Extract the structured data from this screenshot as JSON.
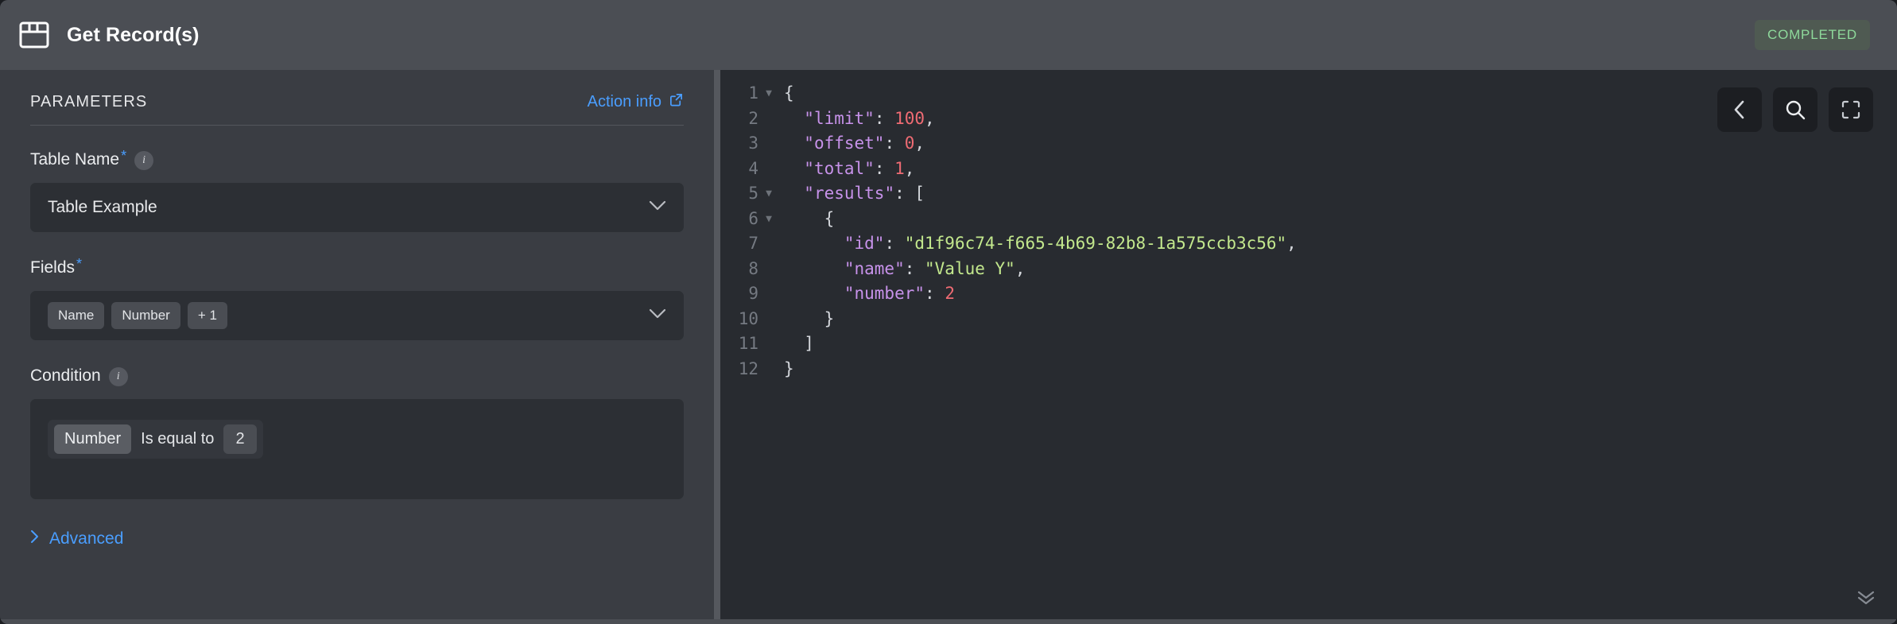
{
  "header": {
    "icon": "table-window-icon",
    "title": "Get Record(s)",
    "status": "COMPLETED",
    "status_color": "#8ed99b"
  },
  "parameters": {
    "section_title": "PARAMETERS",
    "action_info_label": "Action info",
    "action_info_icon": "external-link-icon",
    "table_name": {
      "label": "Table Name",
      "required_marker": "*",
      "info_icon": "info-icon",
      "value": "Table Example",
      "chevron": "chevron-down-icon"
    },
    "fields": {
      "label": "Fields",
      "required_marker": "*",
      "chips": [
        "Name",
        "Number",
        "+ 1"
      ],
      "chevron": "chevron-down-icon"
    },
    "condition": {
      "label": "Condition",
      "info_icon": "info-icon",
      "field": "Number",
      "operator": "Is equal to",
      "value": "2"
    },
    "advanced": {
      "label": "Advanced",
      "chevron": "chevron-right-icon",
      "color": "#4a9eff"
    }
  },
  "code_panel": {
    "toolbar": [
      {
        "name": "back-button",
        "icon": "chevron-left-icon"
      },
      {
        "name": "search-button",
        "icon": "search-icon"
      },
      {
        "name": "fullscreen-button",
        "icon": "fullscreen-icon"
      }
    ],
    "scroll_hint_icon": "double-chevron-down-icon",
    "lines": [
      {
        "n": "1",
        "fold": "▼",
        "indent": 0,
        "tokens": [
          {
            "t": "pun",
            "v": "{"
          }
        ]
      },
      {
        "n": "2",
        "fold": "",
        "indent": 1,
        "tokens": [
          {
            "t": "key",
            "v": "\"limit\""
          },
          {
            "t": "pun",
            "v": ": "
          },
          {
            "t": "num",
            "v": "100"
          },
          {
            "t": "pun",
            "v": ","
          }
        ]
      },
      {
        "n": "3",
        "fold": "",
        "indent": 1,
        "tokens": [
          {
            "t": "key",
            "v": "\"offset\""
          },
          {
            "t": "pun",
            "v": ": "
          },
          {
            "t": "num",
            "v": "0"
          },
          {
            "t": "pun",
            "v": ","
          }
        ]
      },
      {
        "n": "4",
        "fold": "",
        "indent": 1,
        "tokens": [
          {
            "t": "key",
            "v": "\"total\""
          },
          {
            "t": "pun",
            "v": ": "
          },
          {
            "t": "num",
            "v": "1"
          },
          {
            "t": "pun",
            "v": ","
          }
        ]
      },
      {
        "n": "5",
        "fold": "▼",
        "indent": 1,
        "tokens": [
          {
            "t": "key",
            "v": "\"results\""
          },
          {
            "t": "pun",
            "v": ": ["
          }
        ]
      },
      {
        "n": "6",
        "fold": "▼",
        "indent": 2,
        "tokens": [
          {
            "t": "pun",
            "v": "{"
          }
        ]
      },
      {
        "n": "7",
        "fold": "",
        "indent": 3,
        "tokens": [
          {
            "t": "key",
            "v": "\"id\""
          },
          {
            "t": "pun",
            "v": ": "
          },
          {
            "t": "str",
            "v": "\"d1f96c74-f665-4b69-82b8-1a575ccb3c56\""
          },
          {
            "t": "pun",
            "v": ","
          }
        ]
      },
      {
        "n": "8",
        "fold": "",
        "indent": 3,
        "tokens": [
          {
            "t": "key",
            "v": "\"name\""
          },
          {
            "t": "pun",
            "v": ": "
          },
          {
            "t": "str",
            "v": "\"Value Y\""
          },
          {
            "t": "pun",
            "v": ","
          }
        ]
      },
      {
        "n": "9",
        "fold": "",
        "indent": 3,
        "tokens": [
          {
            "t": "key",
            "v": "\"number\""
          },
          {
            "t": "pun",
            "v": ": "
          },
          {
            "t": "num",
            "v": "2"
          }
        ]
      },
      {
        "n": "10",
        "fold": "",
        "indent": 2,
        "tokens": [
          {
            "t": "pun",
            "v": "}"
          }
        ]
      },
      {
        "n": "11",
        "fold": "",
        "indent": 1,
        "tokens": [
          {
            "t": "pun",
            "v": "]"
          }
        ]
      },
      {
        "n": "12",
        "fold": "",
        "indent": 0,
        "tokens": [
          {
            "t": "pun",
            "v": "}"
          }
        ]
      }
    ]
  }
}
